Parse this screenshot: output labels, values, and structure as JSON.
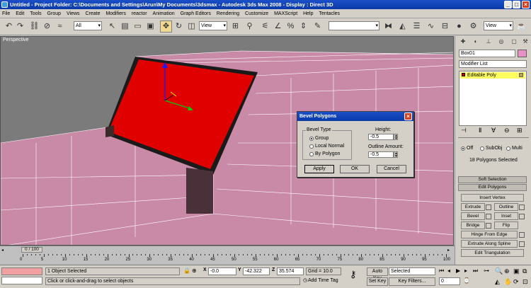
{
  "window": {
    "title": "Untitled    - Project Folder: C:\\Documents and Settings\\Arun\\My Documents\\3dsmax    - Autodesk 3ds Max 2008    - Display : Direct 3D"
  },
  "menu": [
    "File",
    "Edit",
    "Tools",
    "Group",
    "Views",
    "Create",
    "Modifiers",
    "reactor",
    "Animation",
    "Graph Editors",
    "Rendering",
    "Customize",
    "MAXScript",
    "Help",
    "Tentacles"
  ],
  "toolbar": {
    "selection_filter": "All",
    "ref_coord": "View",
    "named_sel": "",
    "view_right": "View"
  },
  "viewport": {
    "label": "Perspective"
  },
  "command_panel": {
    "object_name": "Box01",
    "modifier_list": "Modifier List",
    "stack_item": "Editable Poly",
    "soft_sel": {
      "off": "Off",
      "subobj": "SubObj",
      "multi": "Multi"
    },
    "polys_selected": "18 Polygons Selected",
    "soft_selection": "Soft Selection",
    "edit_polygons": "Edit Polygons",
    "insert_vertex": "Insert Vertex",
    "extrude": "Extrude",
    "outline": "Outline",
    "bevel": "Bevel",
    "inset": "Inset",
    "bridge": "Bridge",
    "flip": "Flip",
    "hinge": "Hinge From Edge",
    "extrude_spline": "Extrude Along Spline",
    "edit_tri": "Edit Triangulation"
  },
  "timeline": {
    "frame": "0 / 100",
    "ticks": [
      "0",
      "5",
      "10",
      "15",
      "20",
      "25",
      "30",
      "35",
      "40",
      "45",
      "50",
      "55",
      "60",
      "65",
      "70",
      "75",
      "80",
      "85",
      "90",
      "95",
      "100"
    ]
  },
  "status": {
    "objects_selected": "1 Object Selected",
    "prompt": "Click or click-and-drag to select objects",
    "x_label": "X",
    "x": "-0.0",
    "y_label": "Y",
    "y": "-42.322",
    "z_label": "Z",
    "z": "35.574",
    "grid": "Grid = 10.0",
    "add_time_tag": "Add Time Tag",
    "auto_key": "Auto Key",
    "set_key": "Set Key",
    "key_mode": "Selected",
    "key_filters": "Key Filters...",
    "frame_field": "0"
  },
  "dialog": {
    "title": "Bevel Polygons",
    "bevel_type": "Bevel Type",
    "group": "Group",
    "local_normal": "Local Normal",
    "by_polygon": "By Polygon",
    "height_label": "Height:",
    "height": "-0.5",
    "outline_label": "Outline Amount:",
    "outline": "-0.5",
    "apply": "Apply",
    "ok": "OK",
    "cancel": "Cancel"
  },
  "colors": {
    "mesh": "#c98aa8",
    "selected_face": "#e00000",
    "titlebar": "#0a3aa8"
  }
}
